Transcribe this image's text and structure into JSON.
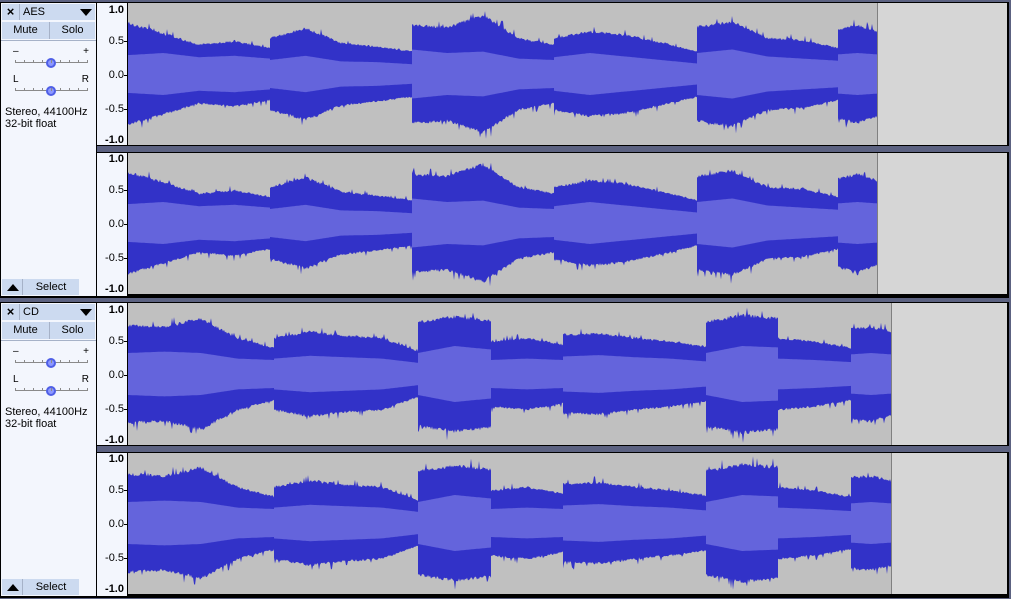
{
  "colors": {
    "peak": "#3232c8",
    "rms": "#6464dc",
    "clip_bg": "#c0c0c0",
    "empty_bg": "#d6d6d6",
    "clip_edge": "#808080"
  },
  "ruler_labels": [
    "1.0",
    "0.5",
    "0.0",
    "-0.5",
    "-1.0"
  ],
  "tracks": [
    {
      "name": "AES",
      "close_label": "×",
      "mute_label": "Mute",
      "solo_label": "Solo",
      "gain_min_label": "–",
      "gain_max_label": "+",
      "pan_left_label": "L",
      "pan_right_label": "R",
      "gain_value": 0.0,
      "pan_value": 0.0,
      "info_line1": "Stereo, 44100Hz",
      "info_line2": "32-bit float",
      "select_label": "Select",
      "clip_end_fraction": 0.852,
      "segments": [
        {
          "start": 0.0,
          "end": 0.162,
          "peak": [
            0.78,
            0.62,
            0.45,
            0.5,
            0.4
          ],
          "rms": [
            0.27,
            0.3,
            0.24,
            0.26,
            0.22
          ]
        },
        {
          "start": 0.162,
          "end": 0.323,
          "peak": [
            0.55,
            0.7,
            0.48,
            0.42,
            0.35
          ],
          "rms": [
            0.2,
            0.26,
            0.18,
            0.17,
            0.14
          ]
        },
        {
          "start": 0.323,
          "end": 0.485,
          "peak": [
            0.75,
            0.72,
            0.9,
            0.55,
            0.45
          ],
          "rms": [
            0.35,
            0.3,
            0.32,
            0.22,
            0.2
          ]
        },
        {
          "start": 0.485,
          "end": 0.647,
          "peak": [
            0.55,
            0.65,
            0.6,
            0.48,
            0.35
          ],
          "rms": [
            0.24,
            0.3,
            0.25,
            0.2,
            0.15
          ]
        },
        {
          "start": 0.647,
          "end": 0.808,
          "peak": [
            0.72,
            0.8,
            0.55,
            0.52,
            0.4
          ],
          "rms": [
            0.3,
            0.35,
            0.25,
            0.22,
            0.19
          ]
        },
        {
          "start": 0.808,
          "end": 0.852,
          "peak": [
            0.68,
            0.75,
            0.65
          ],
          "rms": [
            0.28,
            0.3,
            0.28
          ]
        }
      ]
    },
    {
      "name": "CD",
      "close_label": "×",
      "mute_label": "Mute",
      "solo_label": "Solo",
      "gain_min_label": "–",
      "gain_max_label": "+",
      "pan_left_label": "L",
      "pan_right_label": "R",
      "gain_value": 0.0,
      "pan_value": 0.0,
      "info_line1": "Stereo, 44100Hz",
      "info_line2": "32-bit float",
      "select_label": "Select",
      "clip_end_fraction": 0.868,
      "segments": [
        {
          "start": 0.0,
          "end": 0.166,
          "peak": [
            0.75,
            0.72,
            0.85,
            0.55,
            0.4
          ],
          "rms": [
            0.3,
            0.32,
            0.3,
            0.22,
            0.2
          ]
        },
        {
          "start": 0.166,
          "end": 0.33,
          "peak": [
            0.55,
            0.65,
            0.58,
            0.55,
            0.35
          ],
          "rms": [
            0.22,
            0.26,
            0.24,
            0.22,
            0.16
          ]
        },
        {
          "start": 0.33,
          "end": 0.413,
          "peak": [
            0.8,
            0.88,
            0.82
          ],
          "rms": [
            0.3,
            0.4,
            0.35
          ]
        },
        {
          "start": 0.413,
          "end": 0.495,
          "peak": [
            0.5,
            0.55,
            0.45
          ],
          "rms": [
            0.2,
            0.22,
            0.2
          ]
        },
        {
          "start": 0.495,
          "end": 0.658,
          "peak": [
            0.6,
            0.62,
            0.55,
            0.5,
            0.42
          ],
          "rms": [
            0.25,
            0.27,
            0.24,
            0.22,
            0.18
          ]
        },
        {
          "start": 0.658,
          "end": 0.74,
          "peak": [
            0.8,
            0.9,
            0.85
          ],
          "rms": [
            0.3,
            0.4,
            0.38
          ]
        },
        {
          "start": 0.74,
          "end": 0.822,
          "peak": [
            0.55,
            0.5,
            0.4
          ],
          "rms": [
            0.22,
            0.2,
            0.17
          ]
        },
        {
          "start": 0.822,
          "end": 0.868,
          "peak": [
            0.7,
            0.72,
            0.65
          ],
          "rms": [
            0.28,
            0.3,
            0.28
          ]
        }
      ]
    }
  ]
}
